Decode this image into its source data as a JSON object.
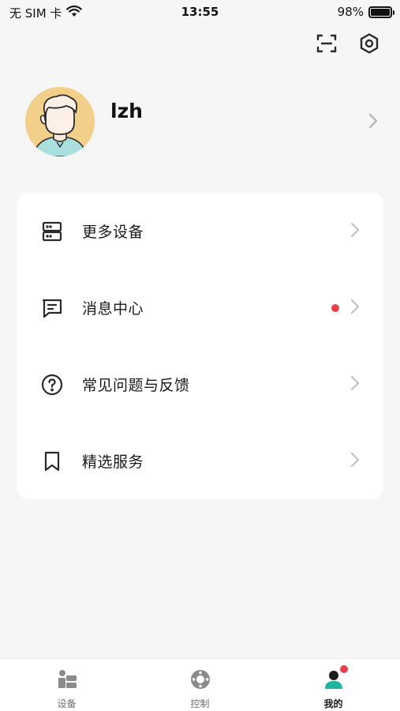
{
  "status_bar": {
    "carrier": "无 SIM 卡",
    "time": "13:55",
    "battery_percent": "98%",
    "battery_level": 0.98
  },
  "header": {
    "actions": [
      {
        "icon": "scan-icon"
      },
      {
        "icon": "settings-hexagon-icon"
      }
    ]
  },
  "profile": {
    "username": "lzh",
    "avatar_icon": "user-avatar-illustration"
  },
  "menu": {
    "items": [
      {
        "label": "更多设备",
        "icon": "devices-server-icon"
      },
      {
        "label": "消息中心",
        "icon": "message-icon",
        "unread": true
      },
      {
        "label": "常见问题与反馈",
        "icon": "question-circle-icon"
      },
      {
        "label": "精选服务",
        "icon": "bookmark-icon"
      }
    ]
  },
  "tabbar": {
    "tabs": [
      {
        "label": "设备",
        "icon": "device-tab-icon",
        "active": false
      },
      {
        "label": "控制",
        "icon": "control-tab-icon",
        "active": false
      },
      {
        "label": "我的",
        "icon": "profile-tab-icon",
        "active": true,
        "badge": true
      }
    ]
  },
  "colors": {
    "background": "#f6f6f6",
    "card": "#ffffff",
    "accent": "#1fb5a0",
    "badge": "#e8414b",
    "avatar_bg": "#f2d08a"
  }
}
